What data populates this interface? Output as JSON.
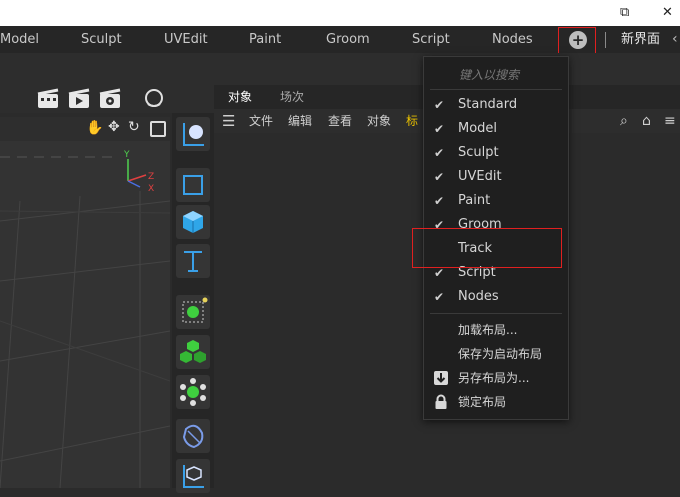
{
  "layout_tabs": [
    "Model",
    "Sculpt",
    "UVEdit",
    "Paint",
    "Groom",
    "Script",
    "Nodes"
  ],
  "new_layout_label": "新界面",
  "panel": {
    "tabs": [
      "对象",
      "场次"
    ],
    "menu": [
      "文件",
      "编辑",
      "查看",
      "对象",
      "标"
    ]
  },
  "dropdown": {
    "search_placeholder": "键入以搜索",
    "layouts": [
      {
        "label": "Standard",
        "checked": true
      },
      {
        "label": "Model",
        "checked": true
      },
      {
        "label": "Sculpt",
        "checked": true
      },
      {
        "label": "UVEdit",
        "checked": true
      },
      {
        "label": "Paint",
        "checked": true
      },
      {
        "label": "Groom",
        "checked": true
      },
      {
        "label": "Track",
        "checked": false
      },
      {
        "label": "Script",
        "checked": true
      },
      {
        "label": "Nodes",
        "checked": true
      }
    ],
    "actions": [
      "加载布局...",
      "保存为启动布局",
      "另存布局为...",
      "锁定布局"
    ]
  },
  "colors": {
    "accent_blue": "#3aa0e8",
    "highlight_red": "#e02020",
    "green_object": "#3fcf3f",
    "axis_y": "#4fd14f",
    "axis_x": "#e04040",
    "axis_z": "#4a6fe0"
  }
}
